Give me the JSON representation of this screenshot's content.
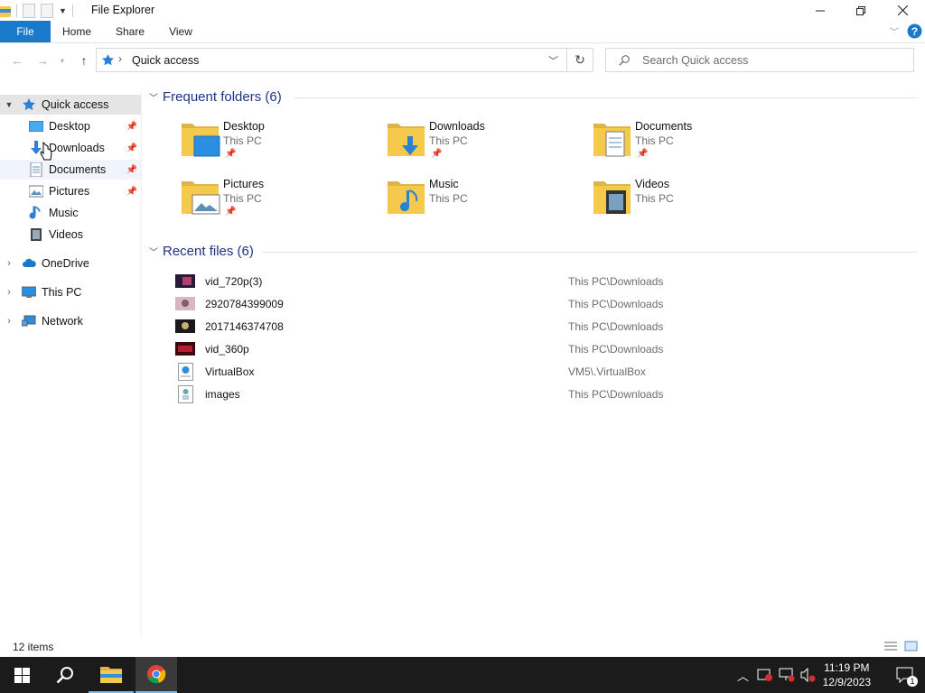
{
  "window": {
    "title": "File Explorer"
  },
  "ribbon": {
    "tabs": [
      "File",
      "Home",
      "Share",
      "View"
    ]
  },
  "address": {
    "path": "Quick access"
  },
  "search": {
    "placeholder": "Search Quick access"
  },
  "nav": {
    "quick_access": "Quick access",
    "pinned": [
      "Desktop",
      "Downloads",
      "Documents",
      "Pictures"
    ],
    "others": [
      "Music",
      "Videos"
    ],
    "roots": [
      "OneDrive",
      "This PC",
      "Network"
    ]
  },
  "frequent": {
    "header": "Frequent folders (6)",
    "items": [
      {
        "name": "Desktop",
        "location": "This PC"
      },
      {
        "name": "Downloads",
        "location": "This PC"
      },
      {
        "name": "Documents",
        "location": "This PC"
      },
      {
        "name": "Pictures",
        "location": "This PC"
      },
      {
        "name": "Music",
        "location": "This PC"
      },
      {
        "name": "Videos",
        "location": "This PC"
      }
    ]
  },
  "recent": {
    "header": "Recent files (6)",
    "items": [
      {
        "name": "vid_720p(3)",
        "path": "This PC\\Downloads"
      },
      {
        "name": "2920784399009",
        "path": "This PC\\Downloads"
      },
      {
        "name": "2017146374708",
        "path": "This PC\\Downloads"
      },
      {
        "name": "vid_360p",
        "path": "This PC\\Downloads"
      },
      {
        "name": "VirtualBox",
        "path": "VM5\\.VirtualBox"
      },
      {
        "name": "images",
        "path": "This PC\\Downloads"
      }
    ]
  },
  "status": {
    "items": "12 items"
  },
  "taskbar": {
    "time": "11:19 PM",
    "date": "12/9/2023",
    "notifications": "1"
  },
  "colors": {
    "accent": "#1979ca",
    "heading": "#1e3287",
    "folder": "#f5c94c",
    "selection": "#e5e5e5"
  }
}
